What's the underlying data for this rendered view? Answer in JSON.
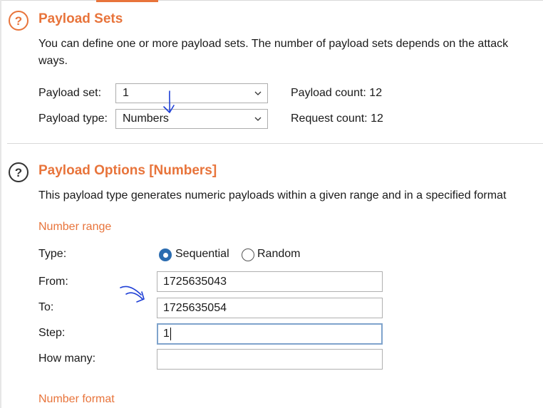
{
  "payload_sets": {
    "title": "Payload Sets",
    "description_line1": "You can define one or more payload sets. The number of payload sets depends on the attack",
    "description_line2": "ways.",
    "payload_set_label": "Payload set:",
    "payload_set_value": "1",
    "payload_type_label": "Payload type:",
    "payload_type_value": "Numbers",
    "payload_count": "Payload count: 12",
    "request_count": "Request count: 12"
  },
  "payload_options": {
    "title": "Payload Options [Numbers]",
    "description": "This payload type generates numeric payloads within a given range and in a specified format",
    "number_range_heading": "Number range",
    "type_label": "Type:",
    "sequential_label": "Sequential",
    "random_label": "Random",
    "selected_type": "Sequential",
    "from_label": "From:",
    "from_value": "1725635043",
    "to_label": "To:",
    "to_value": "1725635054",
    "step_label": "Step:",
    "step_value": "1",
    "how_many_label": "How many:",
    "how_many_value": "",
    "number_format_heading": "Number format"
  },
  "icons": {
    "section_help": "help-icon",
    "dropdown": "chevron-down-icon",
    "annotation_arrow": "handwritten-arrow"
  },
  "colors": {
    "accent": "#e8743b",
    "radio_selected": "#2b6cb0",
    "annotation_ink": "#1e3fd6",
    "focus_border": "#7fa3cc"
  }
}
